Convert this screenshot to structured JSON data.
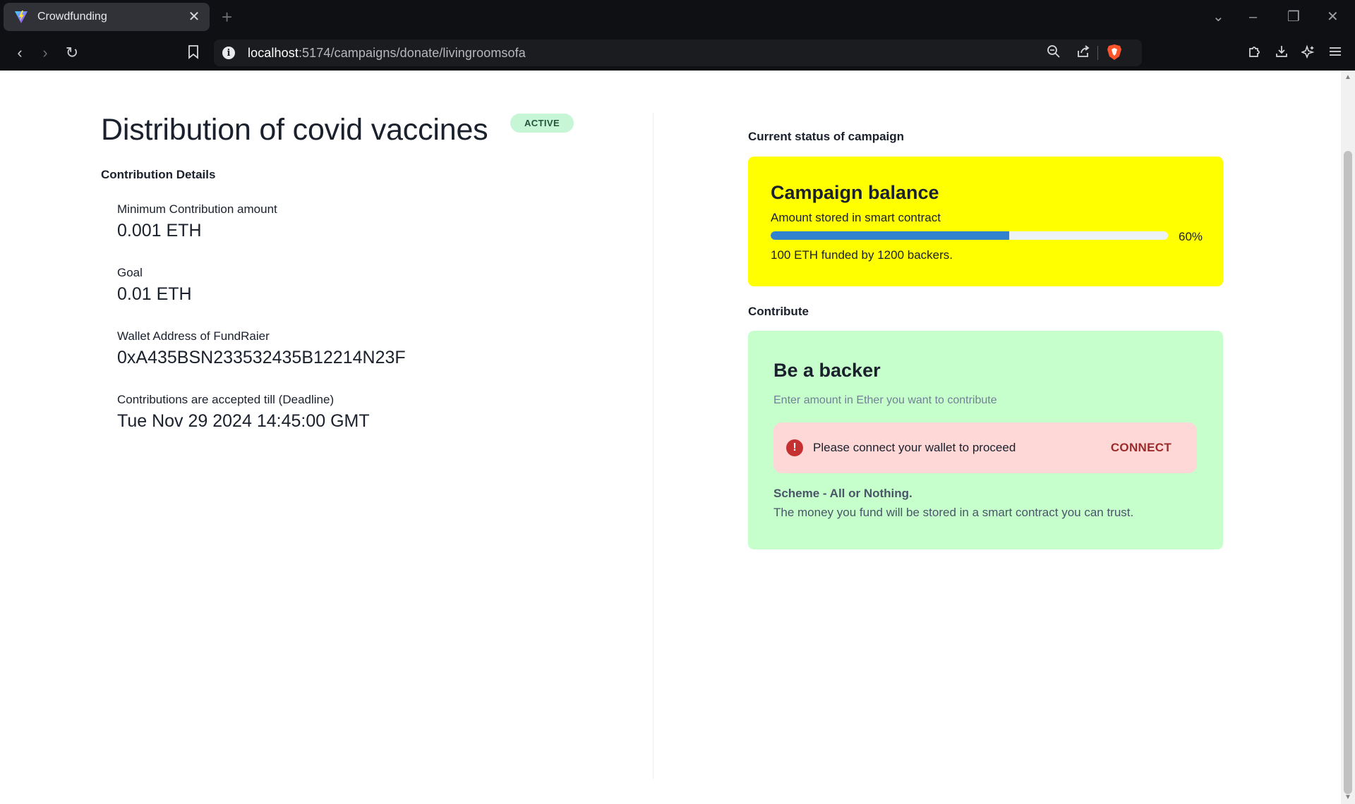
{
  "browser": {
    "tab_title": "Crowdfunding",
    "tab_close": "✕",
    "new_tab": "+",
    "url_host": "localhost",
    "url_path": ":5174/campaigns/donate/livingroomsofa"
  },
  "page": {
    "title": "Distribution of covid vaccines",
    "status_badge": "ACTIVE",
    "contribution_section": "Contribution Details",
    "details": [
      {
        "label": "Minimum Contribution amount",
        "value": "0.001 ETH"
      },
      {
        "label": "Goal",
        "value": "0.01 ETH"
      },
      {
        "label": "Wallet Address of FundRaier",
        "value": "0xA435BSN233532435B12214N23F"
      },
      {
        "label": "Contributions are accepted till (Deadline)",
        "value": "Tue Nov 29 2024 14:45:00 GMT"
      }
    ]
  },
  "status": {
    "section_label": "Current status of campaign",
    "card_title": "Campaign balance",
    "card_subtitle": "Amount stored in smart contract",
    "progress_percent": 60,
    "progress_label": "60%",
    "funded_text": "100 ETH funded by 1200 backers.",
    "card_color": "#ffff00"
  },
  "contribute": {
    "section_label": "Contribute",
    "card_title": "Be a backer",
    "placeholder": "Enter amount in Ether you want to contribute",
    "alert_message": "Please connect your wallet to proceed",
    "connect_button": "CONNECT",
    "scheme_title": "Scheme - All or Nothing.",
    "scheme_text": "The money you fund will be stored in a smart contract you can trust.",
    "card_color": "#c6ffcc"
  }
}
